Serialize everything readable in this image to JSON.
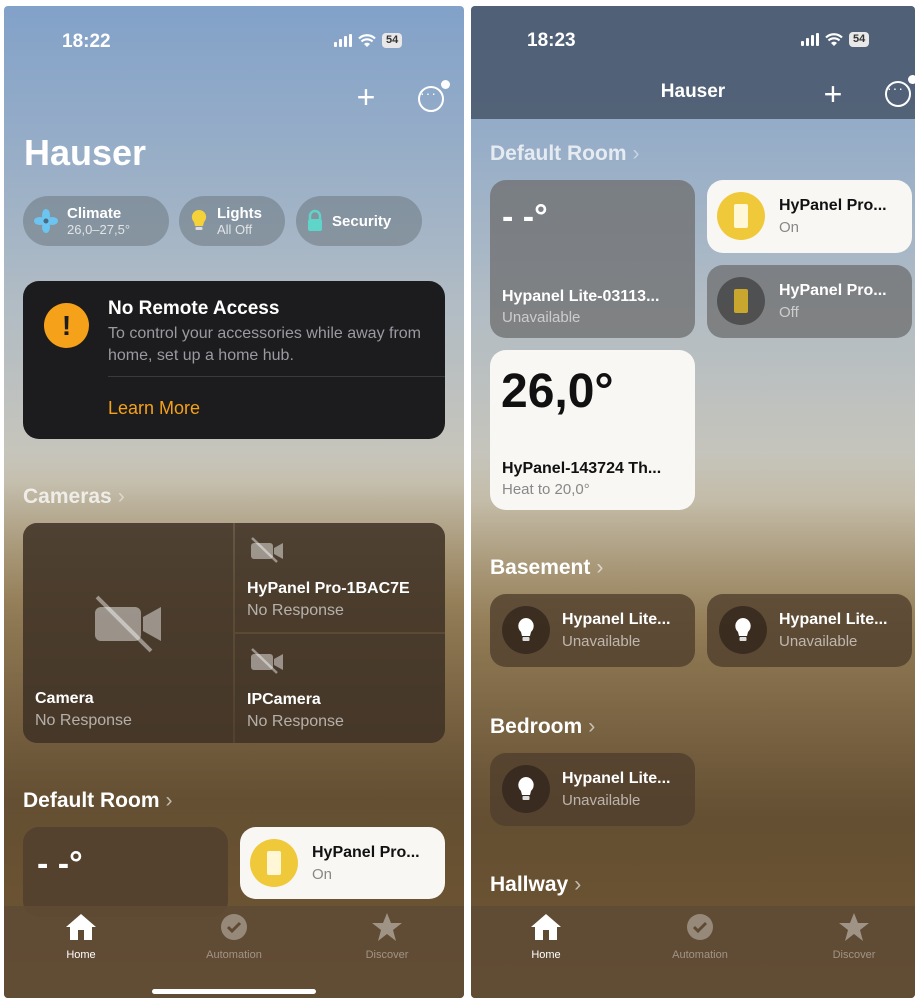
{
  "left": {
    "status": {
      "time": "18:22",
      "battery": "54"
    },
    "home_title": "Hauser",
    "pills": [
      {
        "label": "Climate",
        "sub": "26,0–27,5°"
      },
      {
        "label": "Lights",
        "sub": "All Off"
      },
      {
        "label": "Security"
      }
    ],
    "alert": {
      "title": "No Remote Access",
      "text": "To control your accessories while away from home, set up a home hub.",
      "link": "Learn More"
    },
    "cameras_section": "Cameras",
    "cameras": [
      {
        "name": "Camera",
        "status": "No Response"
      },
      {
        "name": "HyPanel Pro-1BAC7E",
        "status": "No Response"
      },
      {
        "name": "IPCamera",
        "status": "No Response"
      }
    ],
    "default_room_section": "Default Room",
    "tiles": [
      {
        "big": "- -°"
      },
      {
        "name": "HyPanel Pro...",
        "status": "On"
      }
    ]
  },
  "right": {
    "status": {
      "time": "18:23",
      "battery": "54"
    },
    "nav_title": "Hauser",
    "default_room_section": "Default Room",
    "default_tiles": [
      {
        "big": "- -°",
        "name": "Hypanel Lite-03113...",
        "status": "Unavailable"
      },
      {
        "name": "HyPanel Pro...",
        "status": "On"
      },
      {
        "name": "HyPanel Pro...",
        "status": "Off"
      },
      {
        "big": "26,0°",
        "name": "HyPanel-143724 Th...",
        "status": "Heat to 20,0°"
      }
    ],
    "basement_section": "Basement",
    "basement_tiles": [
      {
        "name": "Hypanel Lite...",
        "status": "Unavailable"
      },
      {
        "name": "Hypanel Lite...",
        "status": "Unavailable"
      }
    ],
    "bedroom_section": "Bedroom",
    "bedroom_tiles": [
      {
        "name": "Hypanel Lite...",
        "status": "Unavailable"
      }
    ],
    "hallway_section": "Hallway"
  },
  "tabs": [
    {
      "label": "Home",
      "icon": "home-icon"
    },
    {
      "label": "Automation",
      "icon": "clock-check-icon"
    },
    {
      "label": "Discover",
      "icon": "star-icon"
    }
  ],
  "colors": {
    "accent": "#f5a11a",
    "panel_on": "#f0c93a",
    "alert_bg": "#1c1c1e"
  }
}
